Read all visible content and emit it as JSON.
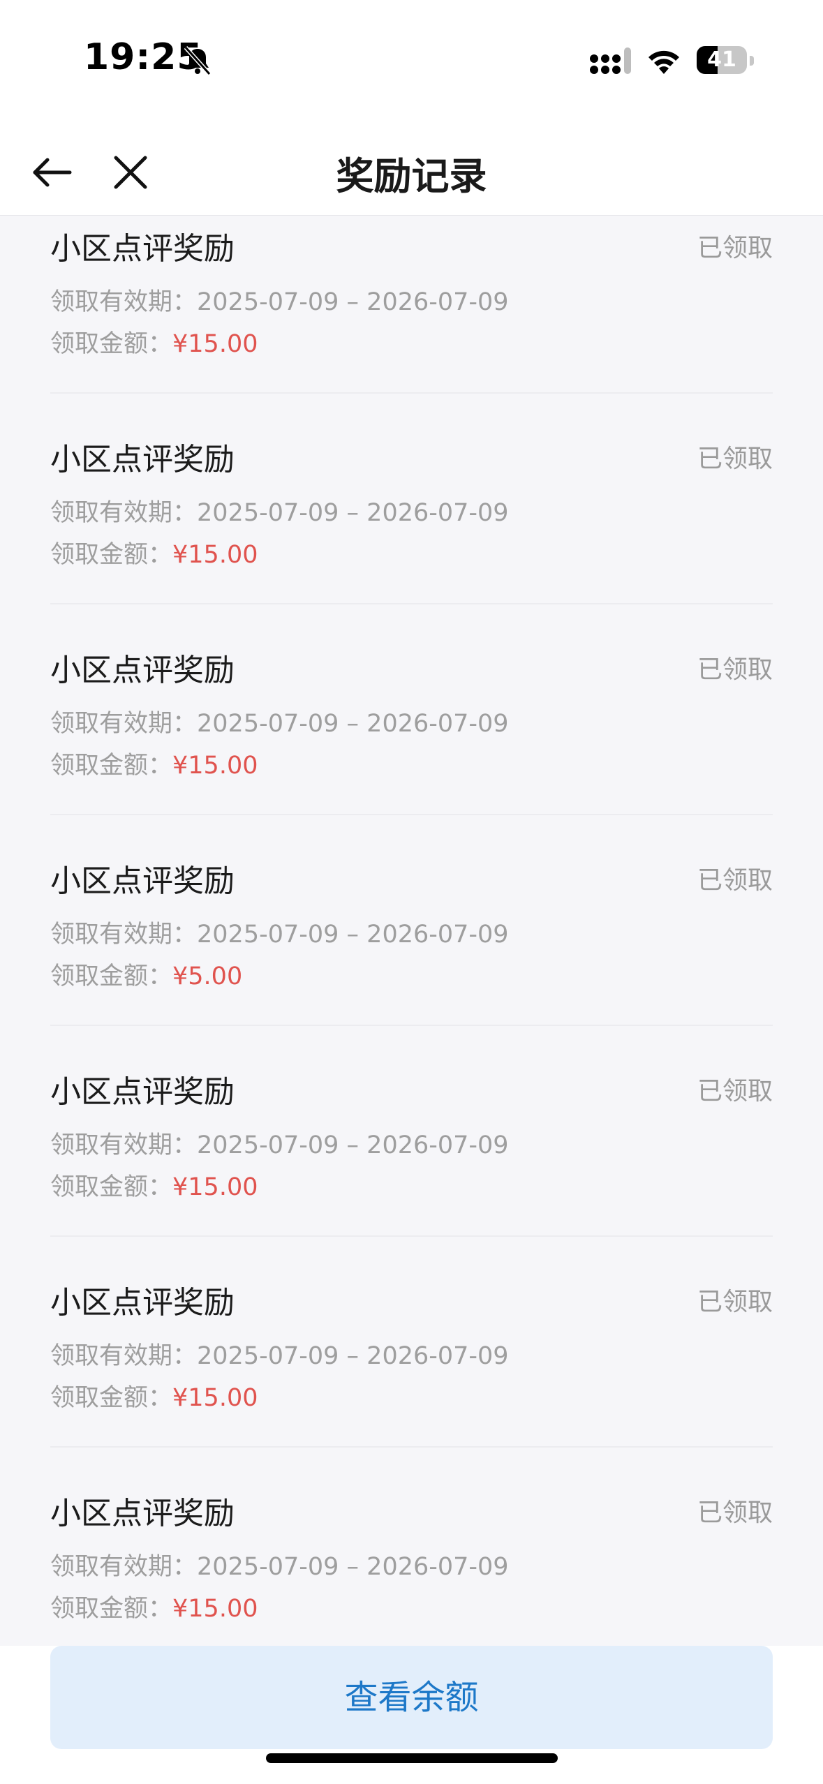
{
  "status_bar": {
    "time": "19:25",
    "battery": "41",
    "battery_level": 0.41
  },
  "nav": {
    "title": "奖励记录"
  },
  "labels": {
    "validity": "领取有效期：",
    "amount": "领取金额："
  },
  "records": [
    {
      "title": "小区点评奖励",
      "status": "已领取",
      "validity": "2025-07-09 – 2026-07-09",
      "amount": "¥15.00"
    },
    {
      "title": "小区点评奖励",
      "status": "已领取",
      "validity": "2025-07-09 – 2026-07-09",
      "amount": "¥15.00"
    },
    {
      "title": "小区点评奖励",
      "status": "已领取",
      "validity": "2025-07-09 – 2026-07-09",
      "amount": "¥15.00"
    },
    {
      "title": "小区点评奖励",
      "status": "已领取",
      "validity": "2025-07-09 – 2026-07-09",
      "amount": "¥5.00"
    },
    {
      "title": "小区点评奖励",
      "status": "已领取",
      "validity": "2025-07-09 – 2026-07-09",
      "amount": "¥15.00"
    },
    {
      "title": "小区点评奖励",
      "status": "已领取",
      "validity": "2025-07-09 – 2026-07-09",
      "amount": "¥15.00"
    },
    {
      "title": "小区点评奖励",
      "status": "已领取",
      "validity": "2025-07-09 – 2026-07-09",
      "amount": "¥15.00"
    }
  ],
  "bottom": {
    "button_label": "查看余额"
  },
  "colors": {
    "amount": "#e0534e",
    "button_bg": "#e2eefb",
    "button_text": "#1d78c8"
  },
  "icons": {
    "nav_back": "arrow-left-icon",
    "nav_close": "close-icon",
    "status": [
      "bell-muted-icon",
      "cellular-signal-icon",
      "wifi-icon",
      "battery-icon"
    ]
  }
}
